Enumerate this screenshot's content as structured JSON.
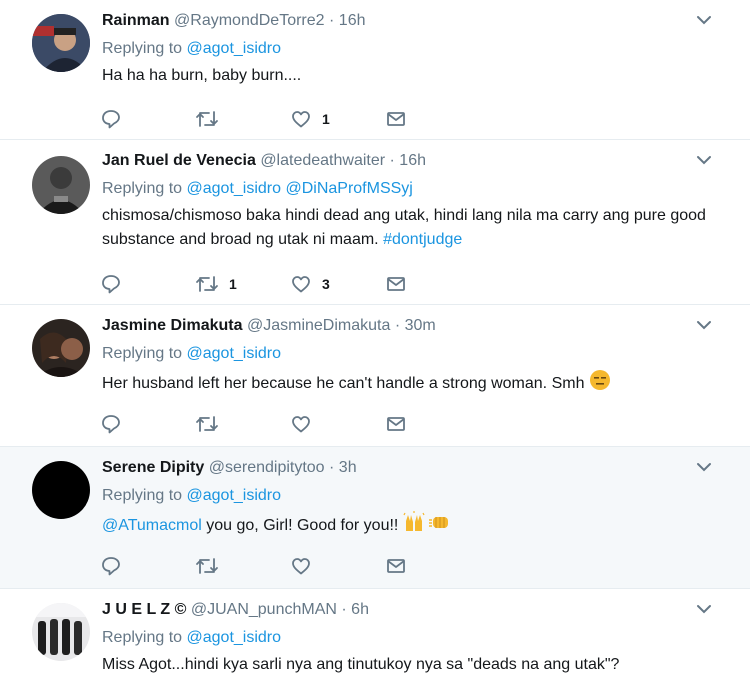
{
  "tweets": [
    {
      "name": "Rainman",
      "handle": "@RaymondDeTorre2",
      "time": "· 16h",
      "replying_prefix": "Replying to",
      "mentions": [
        "@agot_isidro"
      ],
      "text": "Ha ha ha burn, baby burn....",
      "reply_count": "",
      "retweet_count": "",
      "like_count": "1"
    },
    {
      "name": "Jan Ruel de Venecia",
      "handle": "@latedeathwaiter",
      "time": "· 16h",
      "replying_prefix": "Replying to",
      "mentions": [
        "@agot_isidro",
        "@DiNaProfMSSyj"
      ],
      "text": "chismosa/chismoso baka hindi dead ang utak, hindi lang nila ma carry ang pure good substance and broad ng utak ni maam.",
      "hashtag": "#dontjudge",
      "reply_count": "",
      "retweet_count": "1",
      "like_count": "3"
    },
    {
      "name": "Jasmine Dimakuta",
      "handle": "@JasmineDimakuta",
      "time": "· 30m",
      "replying_prefix": "Replying to",
      "mentions": [
        "@agot_isidro"
      ],
      "text": "Her husband left her because he can't handle a strong woman. Smh",
      "emoji": "expressionless-face",
      "reply_count": "",
      "retweet_count": "",
      "like_count": ""
    },
    {
      "name": "Serene Dipity",
      "handle": "@serendipitytoo",
      "time": "· 3h",
      "replying_prefix": "Replying to",
      "mentions": [
        "@agot_isidro"
      ],
      "lead_mention": "@ATumacmol",
      "text": "you go, Girl! Good for you!!",
      "emoji": "raised-hands-and-fist",
      "reply_count": "",
      "retweet_count": "",
      "like_count": ""
    },
    {
      "name": "J U E L Z ©",
      "handle": "@JUAN_punchMAN",
      "time": "· 6h",
      "replying_prefix": "Replying to",
      "mentions": [
        "@agot_isidro"
      ],
      "text": "Miss Agot...hindi kya sarli nya ang tinutukoy nya sa \"deads na ang utak\"?"
    }
  ],
  "colors": {
    "link": "#1b95e0",
    "meta": "#657786",
    "text": "#14171a",
    "icon": "#657786",
    "highlight_bg": "#f5f8fa",
    "divider": "#e6ecf0"
  }
}
